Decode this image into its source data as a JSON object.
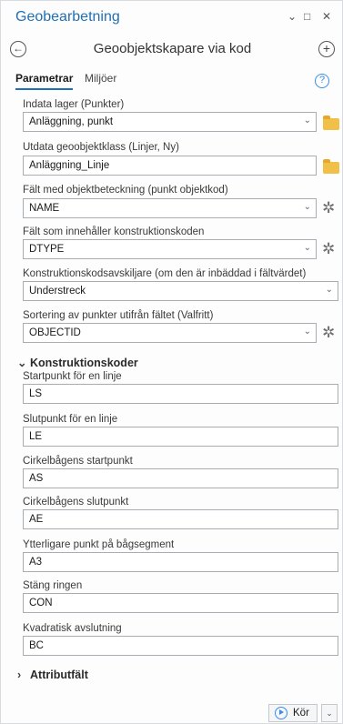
{
  "window": {
    "title": "Geobearbetning",
    "minimize_glyph": "⌄",
    "maximize_glyph": "□",
    "close_glyph": "✕"
  },
  "tool": {
    "title": "Geoobjektskapare via kod",
    "back_icon": "←",
    "add_icon": "+"
  },
  "tabs": [
    {
      "label": "Parametrar",
      "active": true
    },
    {
      "label": "Miljöer",
      "active": false
    }
  ],
  "help_glyph": "?",
  "parameters": [
    {
      "label": "Indata lager (Punkter)",
      "value": "Anläggning, punkt",
      "control": "dropdown-folder"
    },
    {
      "label": "Utdata geoobjektklass (Linjer, Ny)",
      "value": "Anläggning_Linje",
      "control": "folder"
    },
    {
      "label": "Fält med objektbeteckning (punkt objektkod)",
      "value": "NAME",
      "control": "dropdown-gear"
    },
    {
      "label": "Fält som innehåller konstruktionskoden",
      "value": "DTYPE",
      "control": "dropdown-gear"
    },
    {
      "label": "Konstruktionskodsavskiljare (om den är inbäddad i fältvärdet)",
      "value": "Understreck",
      "control": "dropdown"
    },
    {
      "label": "Sortering av punkter utifrån fältet (Valfritt)",
      "value": "OBJECTID",
      "control": "dropdown-gear"
    }
  ],
  "sections": {
    "construction_codes": {
      "label": "Konstruktionskoder",
      "expanded": true
    },
    "attribute_fields": {
      "label": "Attributfält",
      "expanded": false
    }
  },
  "codes": [
    {
      "label": "Startpunkt för en linje",
      "value": "LS"
    },
    {
      "label": "Slutpunkt för en linje",
      "value": "LE"
    },
    {
      "label": "Cirkelbågens startpunkt",
      "value": "AS"
    },
    {
      "label": "Cirkelbågens slutpunkt",
      "value": "AE"
    },
    {
      "label": "Ytterligare punkt på bågsegment",
      "value": "A3"
    },
    {
      "label": "Stäng ringen",
      "value": "CON"
    },
    {
      "label": "Kvadratisk avslutning",
      "value": "BC"
    }
  ],
  "run": {
    "label": "Kör",
    "dropdown_glyph": "⌄"
  },
  "icons": {
    "folder": "folder-icon",
    "gear": "gear-icon",
    "chevron": "chevron-down-icon",
    "play": "play-icon"
  },
  "glyphs": {
    "dropdown": "⌄",
    "gear": "✲",
    "expanded": "⌄",
    "collapsed": "›"
  },
  "colors": {
    "accent": "#1f6fb5",
    "link": "#3a8ee6",
    "folder": "#f0c049"
  }
}
